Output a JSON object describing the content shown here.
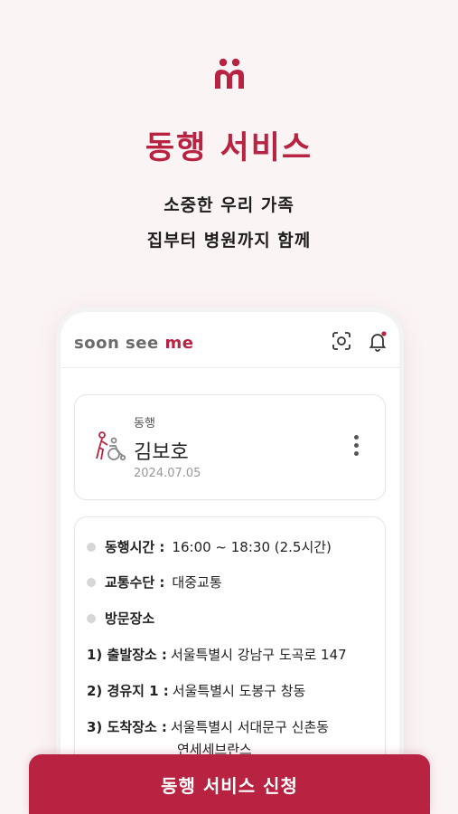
{
  "hero": {
    "title": "동행 서비스",
    "subtitle_line1": "소중한 우리 가족",
    "subtitle_line2": "집부터 병원까지 함께"
  },
  "app": {
    "brand_prefix": "soon see ",
    "brand_suffix": "me",
    "header_icons": [
      "scan-icon",
      "bell-icon"
    ]
  },
  "profile_card": {
    "service_type": "동행",
    "name": "김보호",
    "date": "2024.07.05",
    "icon": "wheelchair-companion-icon"
  },
  "details": {
    "time_label": "동행시간 :",
    "time_value": "16:00 ~ 18:30 (2.5시간)",
    "transport_label": "교통수단 :",
    "transport_value": "대중교통",
    "places_label": "방문장소",
    "places": [
      {
        "label": "1) 출발장소 :",
        "value": "서울특별시 강남구 도곡로 147"
      },
      {
        "label": "2) 경유지 1 :",
        "value": "서울특별시 도봉구 창동"
      },
      {
        "label": "3) 도착장소 :",
        "value": "서울특별시 서대문구 신촌동",
        "value_line2": "연세세브란스"
      }
    ]
  },
  "cta": {
    "label": "동행 서비스 신청"
  },
  "colors": {
    "accent": "#b82341",
    "background": "#fbf4f5"
  }
}
